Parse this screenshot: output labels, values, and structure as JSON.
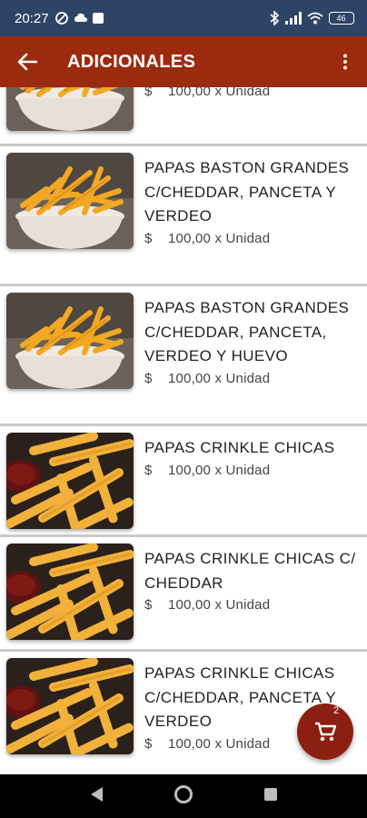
{
  "status_bar": {
    "time": "20:27",
    "battery": "46"
  },
  "app_bar": {
    "title": "ADICIONALES"
  },
  "items": [
    {
      "name": "",
      "price": "$    100,00 x Unidad",
      "image": "straight-fries"
    },
    {
      "name": "PAPAS BASTON GRANDES C/CHEDDAR, PANCETA Y VERDEO",
      "price": "$    100,00 x Unidad",
      "image": "straight-fries"
    },
    {
      "name": "PAPAS BASTON GRANDES C/CHEDDAR, PANCETA, VERDEO Y HUEVO",
      "price": "$    100,00 x Unidad",
      "image": "straight-fries"
    },
    {
      "name": "PAPAS CRINKLE CHICAS",
      "price": "$    100,00 x Unidad",
      "image": "crinkle-fries"
    },
    {
      "name": "PAPAS CRINKLE CHICAS C/ CHEDDAR",
      "price": "$    100,00 x Unidad",
      "image": "crinkle-fries"
    },
    {
      "name": "PAPAS CRINKLE CHICAS C/CHEDDAR, PANCETA Y VERDEO",
      "price": "$    100,00 x Unidad",
      "image": "crinkle-fries"
    }
  ],
  "cart": {
    "count": "2"
  },
  "colors": {
    "status_bar": "#2e4466",
    "app_bar": "#9c2a0e",
    "fab": "#8c1e12"
  }
}
